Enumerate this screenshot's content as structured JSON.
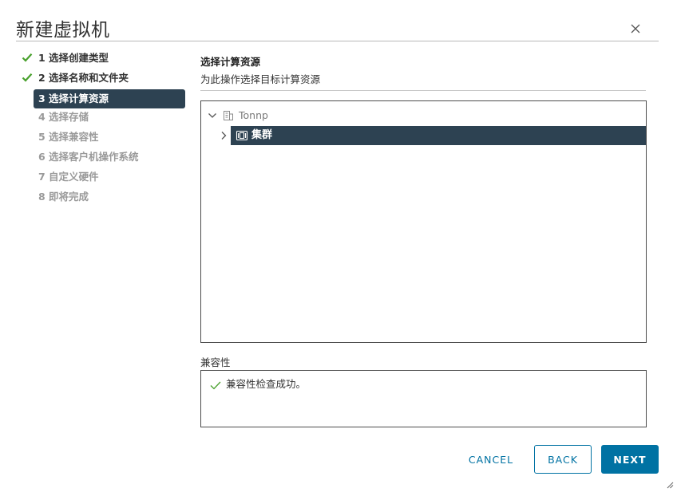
{
  "window": {
    "title": "新建虚拟机"
  },
  "steps": [
    {
      "label": "1 选择创建类型",
      "state": "done"
    },
    {
      "label": "2 选择名称和文件夹",
      "state": "done"
    },
    {
      "label": "3 选择计算资源",
      "state": "active"
    },
    {
      "label": "4 选择存储",
      "state": "todo"
    },
    {
      "label": "5 选择兼容性",
      "state": "todo"
    },
    {
      "label": "6 选择客户机操作系统",
      "state": "todo"
    },
    {
      "label": "7 自定义硬件",
      "state": "todo"
    },
    {
      "label": "8 即将完成",
      "state": "todo"
    }
  ],
  "main": {
    "title": "选择计算资源",
    "subtitle": "为此操作选择目标计算资源",
    "tree": {
      "datacenter": {
        "label": "Tonnp",
        "icon": "datacenter-icon"
      },
      "cluster": {
        "label": "集群",
        "icon": "cluster-icon"
      }
    },
    "compatibility": {
      "title": "兼容性",
      "message": "兼容性检查成功。"
    }
  },
  "buttons": {
    "cancel": "CANCEL",
    "back": "BACK",
    "next": "NEXT"
  },
  "colors": {
    "accent": "#0072a3",
    "selected_bg": "#2d4252",
    "success": "#48a02c"
  }
}
